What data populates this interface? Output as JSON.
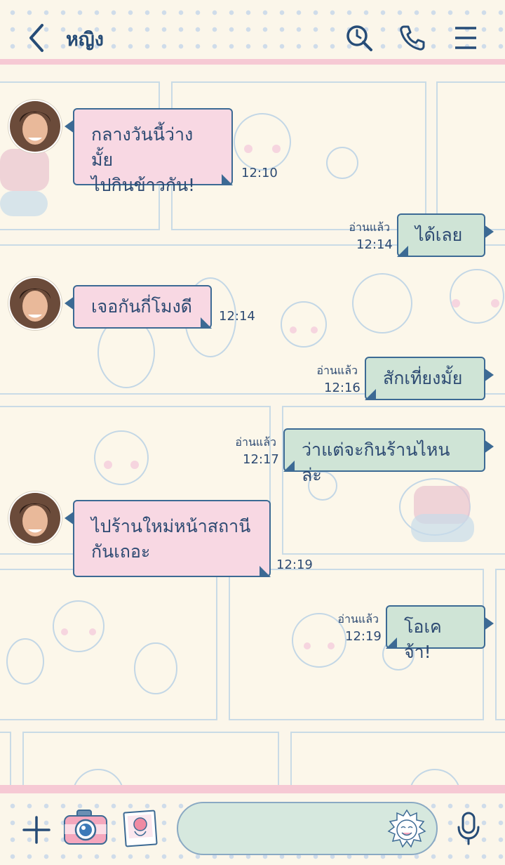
{
  "header": {
    "title": "หญิง",
    "icons": [
      "back-icon",
      "search-history-icon",
      "phone-icon",
      "menu-icon"
    ]
  },
  "colors": {
    "incoming_bubble": "#f8d8e3",
    "outgoing_bubble": "#cfe4d6",
    "bubble_border": "#3c6a94",
    "text": "#2d4a72",
    "stripe": "#f6c9d4",
    "background": "#fbf6ea"
  },
  "messages": [
    {
      "direction": "in",
      "lines": [
        "กลางวันนี้ว่างมั้ย",
        "ไปกินข้าวกัน!"
      ],
      "time": "12:10"
    },
    {
      "direction": "out",
      "text": "ได้เลย",
      "read": "อ่านแล้ว",
      "time": "12:14"
    },
    {
      "direction": "in",
      "lines": [
        "เจอกันกี่โมงดี"
      ],
      "time": "12:14"
    },
    {
      "direction": "out",
      "text": "สักเที่ยงมั้ย",
      "read": "อ่านแล้ว",
      "time": "12:16"
    },
    {
      "direction": "out",
      "text": "ว่าแต่จะกินร้านไหนล่ะ",
      "read": "อ่านแล้ว",
      "time": "12:17"
    },
    {
      "direction": "in",
      "lines": [
        "ไปร้านใหม่หน้าสถานี",
        "กันเถอะ"
      ],
      "time": "12:19"
    },
    {
      "direction": "out",
      "text": "โอเคจ้า!",
      "read": "อ่านแล้ว",
      "time": "12:19"
    }
  ],
  "footer": {
    "icons": [
      "plus-icon",
      "camera-icon",
      "photo-icon",
      "sticker-icon",
      "microphone-icon"
    ]
  }
}
